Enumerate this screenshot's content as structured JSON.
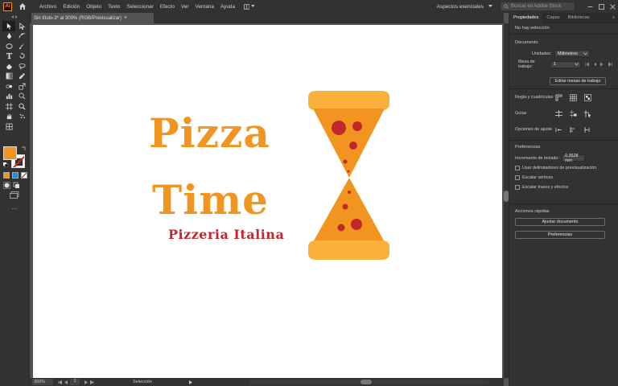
{
  "app": {
    "logo": "Ai"
  },
  "menu": [
    "Archivo",
    "Edición",
    "Objeto",
    "Texto",
    "Seleccionar",
    "Efecto",
    "Ver",
    "Ventana",
    "Ayuda"
  ],
  "header_right": {
    "workspace": "Aspectos esenciales",
    "search_placeholder": "Buscar en Adobe Stock"
  },
  "document": {
    "tab_title": "Sin título-3* al 300% (RGB/Previsualizar)",
    "close": "×"
  },
  "artwork": {
    "word1": "Pizza",
    "word2": "Time",
    "tagline": "Pizzeria Italina",
    "colors": {
      "orange": "#f29520",
      "light_orange": "#fbb03b",
      "red": "#c1272d"
    }
  },
  "status": {
    "zoom": "300%",
    "page": "1",
    "tool": "Selección"
  },
  "panel": {
    "tabs": [
      "Propiedades",
      "Capas",
      "Bibliotecas"
    ],
    "no_selection": "No hay selección",
    "document_title": "Documento",
    "units_label": "Unidades:",
    "units_value": "Milímetros",
    "artboard_label": "Mesa de trabajo:",
    "artboard_value": "1",
    "edit_artboards": "Editar mesas de trabajo",
    "rulers_label": "Regla y cuadrículas",
    "guides_label": "Guías",
    "snap_label": "Opciones de ajuste",
    "prefs_title": "Preferencias",
    "keyboard_increment_label": "Incremento de teclado:",
    "keyboard_increment_value": "0.3528 mm",
    "checkboxes": [
      "Usar delimitadores de previsualización",
      "Escalar vértices",
      "Escalar trazos y efectos"
    ],
    "quick_actions_title": "Acciones rápidas",
    "fit_document": "Ajustar documento",
    "preferences_button": "Preferencias"
  }
}
